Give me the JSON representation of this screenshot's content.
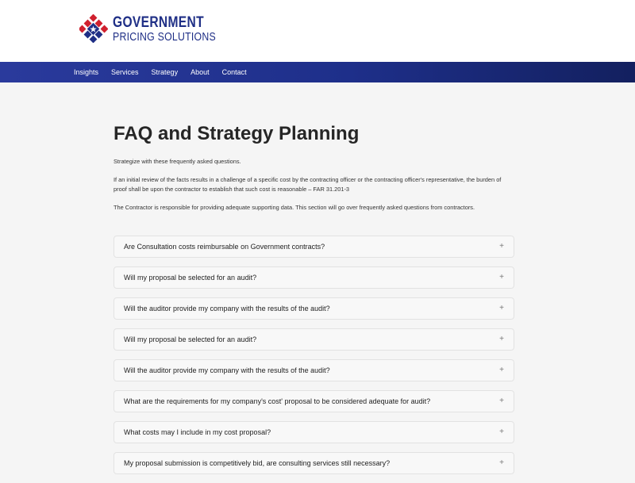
{
  "header": {
    "logo_line1": "GOVERNMENT",
    "logo_line2": "PRICING SOLUTIONS"
  },
  "nav": {
    "items": [
      {
        "label": "Insights"
      },
      {
        "label": "Services"
      },
      {
        "label": "Strategy"
      },
      {
        "label": "About"
      },
      {
        "label": "Contact"
      }
    ]
  },
  "main": {
    "title": "FAQ and Strategy Planning",
    "intro": "Strategize with these frequently asked questions.",
    "quote": "If an initial review of the facts results in a challenge of a specific cost by the contracting officer or the contracting officer's representative, the burden of proof shall be upon the contractor to establish that such cost is reasonable – FAR 31.201-3",
    "note": "The Contractor is responsible for providing adequate supporting data. This section will go over frequently asked questions from contractors."
  },
  "faq": {
    "items": [
      {
        "question": "Are Consultation costs reimbursable on Government contracts?",
        "toggle": "+"
      },
      {
        "question": "Will my proposal be selected for an audit?",
        "toggle": "+"
      },
      {
        "question": "Will the auditor provide my company with the results of the audit?",
        "toggle": "+"
      },
      {
        "question": "Will my proposal be selected for an audit?",
        "toggle": "+"
      },
      {
        "question": "Will the auditor provide my company with the results of the audit?",
        "toggle": "+"
      },
      {
        "question": "What are the requirements for my company's cost' proposal to be considered adequate for audit?",
        "toggle": "+"
      },
      {
        "question": "What costs may I include in my cost proposal?",
        "toggle": "+"
      },
      {
        "question": "My proposal submission is competitively bid, are consulting services still necessary?",
        "toggle": "+"
      }
    ]
  },
  "colors": {
    "brand_blue": "#1f2f86",
    "brand_red": "#d0202e",
    "nav_gradient_start": "#2a3a9c",
    "nav_gradient_end": "#13205f"
  }
}
